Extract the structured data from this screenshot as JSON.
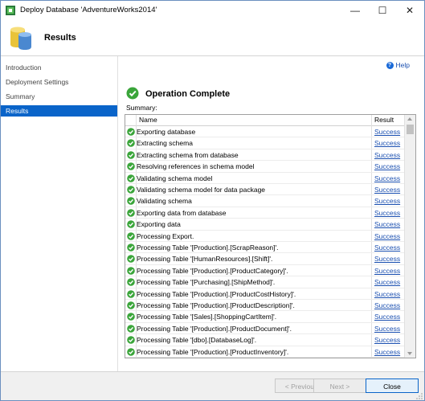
{
  "window": {
    "title": "Deploy Database 'AdventureWorks2014'",
    "minimize_glyph": "—",
    "maximize_glyph": "☐",
    "close_glyph": "✕"
  },
  "header": {
    "title": "Results",
    "icon": "database-icon"
  },
  "sidebar": {
    "items": [
      {
        "label": "Introduction",
        "active": false
      },
      {
        "label": "Deployment Settings",
        "active": false
      },
      {
        "label": "Summary",
        "active": false
      },
      {
        "label": "Results",
        "active": true
      }
    ]
  },
  "main": {
    "help_label": "Help",
    "help_glyph": "?",
    "operation_title": "Operation Complete",
    "summary_label": "Summary:",
    "table": {
      "columns": [
        "Name",
        "Result"
      ],
      "rows": [
        {
          "name": "Exporting database",
          "result": "Success"
        },
        {
          "name": "Extracting schema",
          "result": "Success"
        },
        {
          "name": "Extracting schema from database",
          "result": "Success"
        },
        {
          "name": "Resolving references in schema model",
          "result": "Success"
        },
        {
          "name": "Validating schema model",
          "result": "Success"
        },
        {
          "name": "Validating schema model for data package",
          "result": "Success"
        },
        {
          "name": "Validating schema",
          "result": "Success"
        },
        {
          "name": "Exporting data from database",
          "result": "Success"
        },
        {
          "name": "Exporting data",
          "result": "Success"
        },
        {
          "name": "Processing Export.",
          "result": "Success"
        },
        {
          "name": "Processing Table '[Production].[ScrapReason]'.",
          "result": "Success"
        },
        {
          "name": "Processing Table '[HumanResources].[Shift]'.",
          "result": "Success"
        },
        {
          "name": "Processing Table '[Production].[ProductCategory]'.",
          "result": "Success"
        },
        {
          "name": "Processing Table '[Purchasing].[ShipMethod]'.",
          "result": "Success"
        },
        {
          "name": "Processing Table '[Production].[ProductCostHistory]'.",
          "result": "Success"
        },
        {
          "name": "Processing Table '[Production].[ProductDescription]'.",
          "result": "Success"
        },
        {
          "name": "Processing Table '[Sales].[ShoppingCartItem]'.",
          "result": "Success"
        },
        {
          "name": "Processing Table '[Production].[ProductDocument]'.",
          "result": "Success"
        },
        {
          "name": "Processing Table '[dbo].[DatabaseLog]'.",
          "result": "Success"
        },
        {
          "name": "Processing Table '[Production].[ProductInventory]'.",
          "result": "Success"
        }
      ]
    }
  },
  "footer": {
    "previous_label": "< Previous",
    "next_label": "Next >",
    "close_label": "Close"
  },
  "colors": {
    "accent": "#0a64c9",
    "success_green": "#3aa53a",
    "link": "#1a4fb0"
  }
}
